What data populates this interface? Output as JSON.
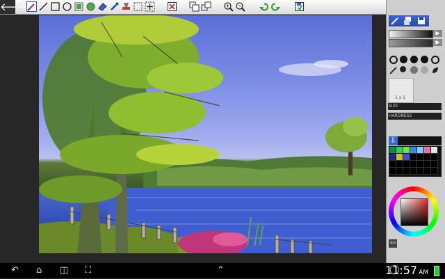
{
  "toolbar": {
    "icons": [
      "back-icon",
      "pencil-icon",
      "line-icon",
      "rectangle-icon",
      "ellipse-icon",
      "fill-icon",
      "gradient-icon",
      "eraser-icon",
      "eyedropper-icon",
      "stamp-icon",
      "select-icon",
      "move-icon",
      "clear-icon",
      "layers-icon",
      "copy-icon",
      "zoom-in-icon",
      "zoom-out-icon",
      "undo-icon",
      "redo-icon",
      "save-icon"
    ]
  },
  "panel": {
    "brush_size_label": "SIZE",
    "hardness_label": "HARDNESS",
    "preview_label": "1 x 1",
    "colors": {
      "palette_row1": [
        "#0f8f3f",
        "#33d25a",
        "#6ee44a",
        "#2f8fe8",
        "#7fd0f8",
        "#ff6aa8",
        "#e6e6e6"
      ],
      "palette_row2": [
        "#1e2a8a",
        "#d0c020",
        "#3c4cd8",
        "#000000",
        "#000000",
        "#000000",
        "#000000"
      ],
      "picker_center": "#d23a3a"
    }
  },
  "navbar": {
    "time": "11:57",
    "am_pm": "AM",
    "icons": [
      "back-nav-icon",
      "home-nav-icon",
      "recent-apps-icon",
      "screenshot-icon",
      "up-chevron-icon",
      "alarm-icon",
      "battery-icon"
    ]
  }
}
